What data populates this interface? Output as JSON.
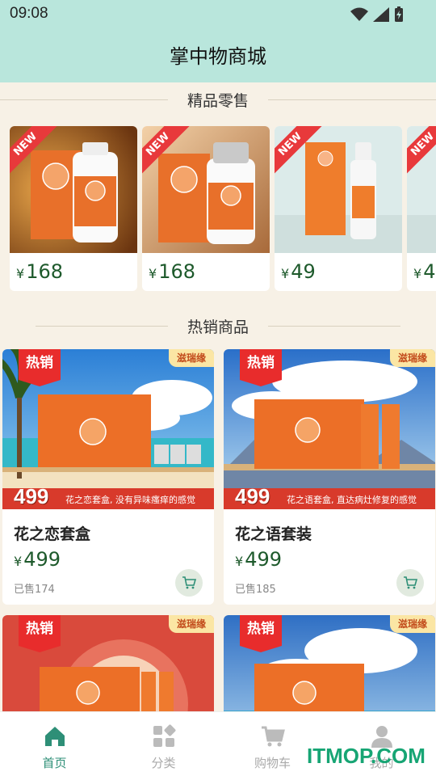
{
  "status": {
    "time": "09:08"
  },
  "header": {
    "title": "掌中物商城"
  },
  "sections": {
    "retail": "精品零售",
    "hot": "热销商品"
  },
  "retail_items": [
    {
      "tag": "NEW",
      "currency": "¥",
      "price": "168"
    },
    {
      "tag": "NEW",
      "currency": "¥",
      "price": "168"
    },
    {
      "tag": "NEW",
      "currency": "¥",
      "price": "49"
    },
    {
      "tag": "NEW",
      "currency": "¥",
      "price": "4"
    }
  ],
  "hot_items": [
    {
      "badge": "热销",
      "brand": "滋瑞缘",
      "promo_num": "499",
      "promo_text": "花之恋套盒, 没有异味瘙痒的感觉",
      "name": "花之恋套盒",
      "currency": "¥",
      "price": "499",
      "sold": "已售174"
    },
    {
      "badge": "热销",
      "brand": "滋瑞缘",
      "promo_num": "499",
      "promo_text": "花之语套盒, 直达病灶修复的感觉",
      "name": "花之语套装",
      "currency": "¥",
      "price": "499",
      "sold": "已售185"
    },
    {
      "badge": "热销",
      "brand": "滋瑞缘"
    },
    {
      "badge": "热销",
      "brand": "滋瑞缘"
    }
  ],
  "tabs": [
    {
      "label": "首页",
      "icon": "home-icon",
      "active": true
    },
    {
      "label": "分类",
      "icon": "category-icon",
      "active": false
    },
    {
      "label": "购物车",
      "icon": "cart-icon",
      "active": false
    },
    {
      "label": "我的",
      "icon": "user-icon",
      "active": false
    }
  ],
  "watermark": "ITMOP.COM",
  "colors": {
    "header_bg": "#b9e6dc",
    "page_bg": "#f7f1e6",
    "price": "#1e5a2c",
    "accent": "#2e8f77",
    "hot_red": "#e82c2c"
  }
}
